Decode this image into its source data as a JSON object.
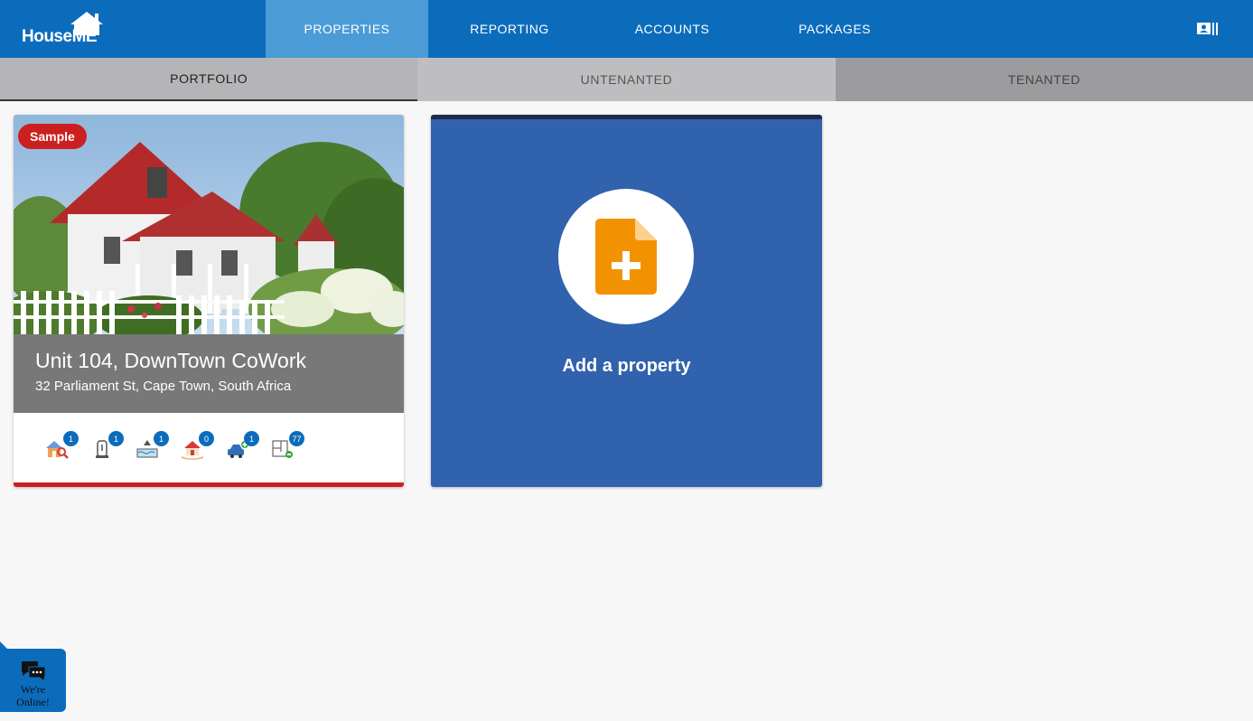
{
  "brand": {
    "logo_text_a": "House",
    "logo_text_b": "ME"
  },
  "nav": {
    "tabs": [
      {
        "label": "PROPERTIES",
        "active": true
      },
      {
        "label": "REPORTING",
        "active": false
      },
      {
        "label": "ACCOUNTS",
        "active": false
      },
      {
        "label": "PACKAGES",
        "active": false
      }
    ],
    "account_icon": "account-card-icon"
  },
  "subtabs": [
    {
      "label": "PORTFOLIO",
      "active": true
    },
    {
      "label": "UNTENANTED",
      "active": false
    },
    {
      "label": "TENANTED",
      "active": false
    }
  ],
  "property": {
    "badge": "Sample",
    "title": "Unit 104, DownTown CoWork",
    "address": "32 Parliament St, Cape Town, South Africa",
    "stats": [
      {
        "icon": "house-search-icon",
        "count": "1"
      },
      {
        "icon": "water-heater-icon",
        "count": "1"
      },
      {
        "icon": "pool-icon",
        "count": "1"
      },
      {
        "icon": "house-hand-icon",
        "count": "0"
      },
      {
        "icon": "car-add-icon",
        "count": "1"
      },
      {
        "icon": "floor-plan-icon",
        "count": "77"
      }
    ]
  },
  "add_property": {
    "label": "Add a property",
    "icon": "file-plus-icon"
  },
  "chat": {
    "line1": "We're",
    "line2": "Online!"
  },
  "colors": {
    "nav_blue": "#0c6cbc",
    "active_tab": "#4b9bd6",
    "add_card": "#3162ad",
    "sample_red": "#cc1f1f",
    "file_orange": "#f39200"
  }
}
